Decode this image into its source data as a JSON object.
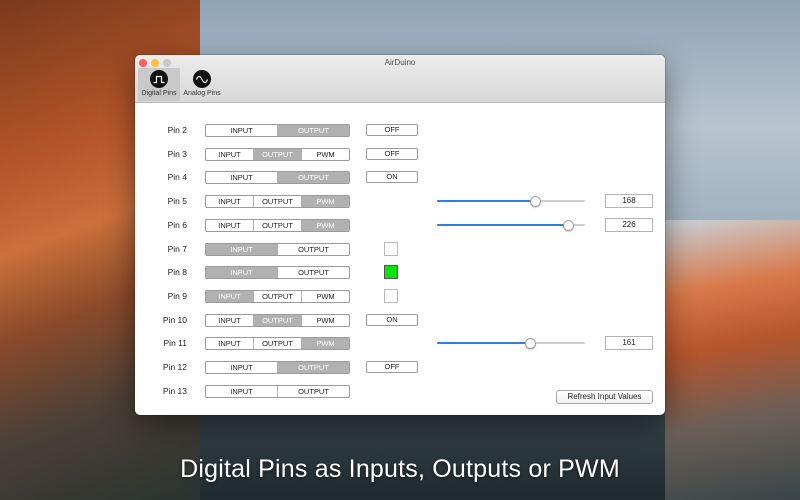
{
  "window": {
    "title": "AirDuino"
  },
  "toolbar": {
    "tabs": [
      {
        "label": "Digital Pins",
        "icon": "square-wave-icon"
      },
      {
        "label": "Analog Pins",
        "icon": "sine-wave-icon"
      }
    ]
  },
  "pins": [
    {
      "label": "Pin 2",
      "modes": [
        "INPUT",
        "OUTPUT"
      ],
      "selected": "OUTPUT",
      "control": {
        "type": "toggle",
        "value": "OFF"
      }
    },
    {
      "label": "Pin 3",
      "modes": [
        "INPUT",
        "OUTPUT",
        "PWM"
      ],
      "selected": "OUTPUT",
      "control": {
        "type": "toggle",
        "value": "OFF"
      }
    },
    {
      "label": "Pin 4",
      "modes": [
        "INPUT",
        "OUTPUT"
      ],
      "selected": "OUTPUT",
      "control": {
        "type": "toggle",
        "value": "ON"
      }
    },
    {
      "label": "Pin 5",
      "modes": [
        "INPUT",
        "OUTPUT",
        "PWM"
      ],
      "selected": "PWM",
      "control": {
        "type": "slider",
        "value": "168",
        "level": 168,
        "max": 255
      }
    },
    {
      "label": "Pin 6",
      "modes": [
        "INPUT",
        "OUTPUT",
        "PWM"
      ],
      "selected": "PWM",
      "control": {
        "type": "slider",
        "value": "226",
        "level": 226,
        "max": 255
      }
    },
    {
      "label": "Pin 7",
      "modes": [
        "INPUT",
        "OUTPUT"
      ],
      "selected": "INPUT",
      "control": {
        "type": "indicator",
        "on": false
      }
    },
    {
      "label": "Pin 8",
      "modes": [
        "INPUT",
        "OUTPUT"
      ],
      "selected": "INPUT",
      "control": {
        "type": "indicator",
        "on": true
      }
    },
    {
      "label": "Pin 9",
      "modes": [
        "INPUT",
        "OUTPUT",
        "PWM"
      ],
      "selected": "INPUT",
      "control": {
        "type": "indicator",
        "on": false
      }
    },
    {
      "label": "Pin 10",
      "modes": [
        "INPUT",
        "OUTPUT",
        "PWM"
      ],
      "selected": "OUTPUT",
      "control": {
        "type": "toggle",
        "value": "ON"
      }
    },
    {
      "label": "Pin 11",
      "modes": [
        "INPUT",
        "OUTPUT",
        "PWM"
      ],
      "selected": "PWM",
      "control": {
        "type": "slider",
        "value": "161",
        "level": 161,
        "max": 255
      }
    },
    {
      "label": "Pin 12",
      "modes": [
        "INPUT",
        "OUTPUT"
      ],
      "selected": "OUTPUT",
      "control": {
        "type": "toggle",
        "value": "OFF"
      }
    },
    {
      "label": "Pin 13",
      "modes": [
        "INPUT",
        "OUTPUT"
      ],
      "selected": "",
      "control": {
        "type": "none"
      }
    }
  ],
  "refresh_label": "Refresh Input Values",
  "caption": "Digital Pins as Inputs, Outputs or PWM",
  "colors": {
    "accent": "#2f7ee0",
    "indicator_on": "#10e010",
    "segment_selected": "#b1b1b1"
  }
}
